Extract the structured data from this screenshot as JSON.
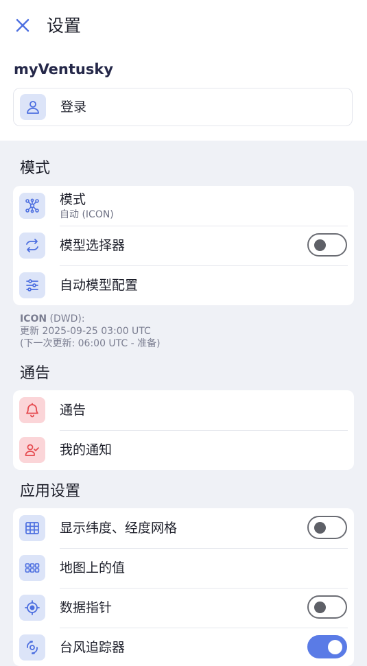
{
  "header": {
    "title": "设置"
  },
  "account": {
    "title": "myVentusky",
    "login_label": "登录"
  },
  "models": {
    "section_title": "模式",
    "items": [
      {
        "label": "模式",
        "sublabel": "自动 (ICON)"
      },
      {
        "label": "模型选择器",
        "toggle_on": false
      },
      {
        "label": "自动模型配置"
      }
    ],
    "info": {
      "model_name": "ICON",
      "model_source": " (DWD):",
      "updated": "更新 2025-09-25 03:00 UTC",
      "next_update": "(下一次更新: 06:00 UTC - 准备)"
    }
  },
  "notices": {
    "section_title": "通告",
    "items": [
      {
        "label": "通告"
      },
      {
        "label": "我的通知"
      }
    ]
  },
  "app_settings": {
    "section_title": "应用设置",
    "items": [
      {
        "label": "显示纬度、经度网格",
        "toggle_on": false
      },
      {
        "label": "地图上的值"
      },
      {
        "label": "数据指针",
        "toggle_on": false
      },
      {
        "label": "台风追踪器",
        "toggle_on": true
      }
    ]
  },
  "colors": {
    "accent": "#5a7be6",
    "icon_bg_blue": "#dce4f8",
    "icon_bg_red": "#fbd5d8",
    "alert_red": "#e5484d"
  }
}
